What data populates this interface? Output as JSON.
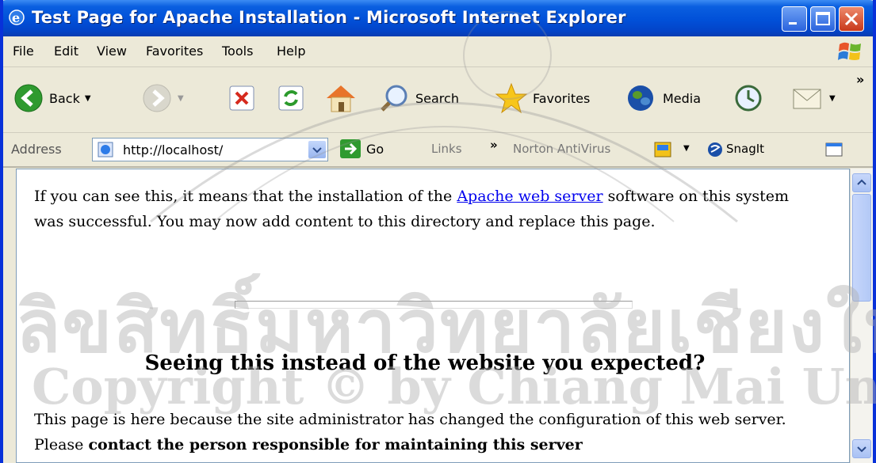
{
  "window": {
    "title": "Test Page for Apache Installation - Microsoft Internet Explorer"
  },
  "menu": [
    "File",
    "Edit",
    "View",
    "Favorites",
    "Tools",
    "Help"
  ],
  "toolbar": {
    "back_label": "Back",
    "search_label": "Search",
    "favorites_label": "Favorites",
    "media_label": "Media",
    "overflow": "»"
  },
  "address": {
    "label": "Address",
    "url": "http://localhost/",
    "go_label": "Go",
    "links_label": "Links",
    "links_overflow": "»",
    "norton_label": "Norton AntiVirus",
    "snagit_label": "SnagIt"
  },
  "page": {
    "intro_before": "If you can see this, it means that the installation of the ",
    "intro_link": "Apache web server",
    "intro_after": " software on this system was successful. You may now add content to this directory and replace this page.",
    "heading": "Seeing this instead of the website you expected?",
    "p2_start": "This page is here because the site administrator has changed the configuration of this web server. Please ",
    "p2_bold": "contact the person responsible for maintaining this server"
  },
  "watermark": {
    "thai": "ลิขสิทธิ์มหาวิทยาลัยเชียงใหม่",
    "copyright": "Copyright © by Chiang Mai University"
  },
  "colors": {
    "titlebar": "#0150d8",
    "link": "#0000ee"
  }
}
